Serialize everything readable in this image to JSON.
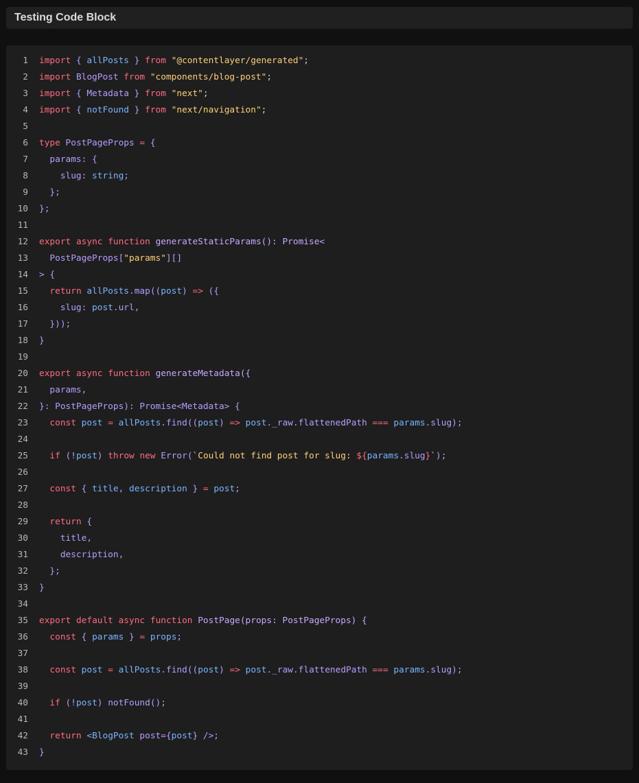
{
  "header": {
    "title": "Testing Code Block"
  },
  "colors": {
    "background": "#101010",
    "panel": "#1e1e1e",
    "keyword": "#ff6b81",
    "string": "#ffcf7a",
    "identifier": "#b79dff",
    "variable": "#7ab4ff",
    "line_number": "#b8b8b8"
  },
  "code": {
    "language": "tsx",
    "lines": [
      [
        [
          "kw",
          "import"
        ],
        [
          "id",
          " { "
        ],
        [
          "var",
          "allPosts"
        ],
        [
          "id",
          " } "
        ],
        [
          "kw",
          "from"
        ],
        [
          "pl",
          " "
        ],
        [
          "str",
          "\"@contentlayer/generated\""
        ],
        [
          "pl",
          ";"
        ]
      ],
      [
        [
          "kw",
          "import"
        ],
        [
          "id",
          " BlogPost "
        ],
        [
          "kw",
          "from"
        ],
        [
          "pl",
          " "
        ],
        [
          "str",
          "\"components/blog-post\""
        ],
        [
          "pl",
          ";"
        ]
      ],
      [
        [
          "kw",
          "import"
        ],
        [
          "id",
          " { Metadata } "
        ],
        [
          "kw",
          "from"
        ],
        [
          "pl",
          " "
        ],
        [
          "str",
          "\"next\""
        ],
        [
          "pl",
          ";"
        ]
      ],
      [
        [
          "kw",
          "import"
        ],
        [
          "id",
          " { "
        ],
        [
          "var",
          "notFound"
        ],
        [
          "id",
          " } "
        ],
        [
          "kw",
          "from"
        ],
        [
          "pl",
          " "
        ],
        [
          "str",
          "\"next/navigation\""
        ],
        [
          "pl",
          ";"
        ]
      ],
      [],
      [
        [
          "kw",
          "type"
        ],
        [
          "id",
          " PostPageProps "
        ],
        [
          "kw",
          "="
        ],
        [
          "id",
          " {"
        ]
      ],
      [
        [
          "id",
          "  params: {"
        ]
      ],
      [
        [
          "id",
          "    slug: "
        ],
        [
          "var",
          "string"
        ],
        [
          "id",
          ";"
        ]
      ],
      [
        [
          "id",
          "  };"
        ]
      ],
      [
        [
          "id",
          "};"
        ]
      ],
      [],
      [
        [
          "kw",
          "export"
        ],
        [
          "pl",
          " "
        ],
        [
          "kw",
          "async"
        ],
        [
          "pl",
          " "
        ],
        [
          "kw",
          "function"
        ],
        [
          "pl",
          " "
        ],
        [
          "fn",
          "generateStaticParams(): Promise<"
        ]
      ],
      [
        [
          "id",
          "  PostPageProps["
        ],
        [
          "str",
          "\"params\""
        ],
        [
          "id",
          "][]"
        ]
      ],
      [
        [
          "id",
          "> {"
        ]
      ],
      [
        [
          "id",
          "  "
        ],
        [
          "kw",
          "return"
        ],
        [
          "id",
          " "
        ],
        [
          "var",
          "allPosts"
        ],
        [
          "id",
          ".map(("
        ],
        [
          "var",
          "post"
        ],
        [
          "id",
          ") "
        ],
        [
          "kw",
          "=>"
        ],
        [
          "id",
          " ({"
        ]
      ],
      [
        [
          "id",
          "    slug: "
        ],
        [
          "var",
          "post"
        ],
        [
          "id",
          ".url,"
        ]
      ],
      [
        [
          "id",
          "  }));"
        ]
      ],
      [
        [
          "id",
          "}"
        ]
      ],
      [],
      [
        [
          "kw",
          "export"
        ],
        [
          "pl",
          " "
        ],
        [
          "kw",
          "async"
        ],
        [
          "pl",
          " "
        ],
        [
          "kw",
          "function"
        ],
        [
          "pl",
          " "
        ],
        [
          "fn",
          "generateMetadata({"
        ]
      ],
      [
        [
          "id",
          "  params,"
        ]
      ],
      [
        [
          "id",
          "}: PostPageProps): Promise<Metadata> {"
        ]
      ],
      [
        [
          "id",
          "  "
        ],
        [
          "kw",
          "const"
        ],
        [
          "id",
          " "
        ],
        [
          "var",
          "post"
        ],
        [
          "id",
          " "
        ],
        [
          "kw",
          "="
        ],
        [
          "id",
          " "
        ],
        [
          "var",
          "allPosts"
        ],
        [
          "id",
          ".find(("
        ],
        [
          "var",
          "post"
        ],
        [
          "id",
          ") "
        ],
        [
          "kw",
          "=>"
        ],
        [
          "id",
          " "
        ],
        [
          "var",
          "post"
        ],
        [
          "id",
          "._raw.flattenedPath "
        ],
        [
          "kw",
          "==="
        ],
        [
          "id",
          " "
        ],
        [
          "var",
          "params"
        ],
        [
          "id",
          ".slug);"
        ]
      ],
      [],
      [
        [
          "id",
          "  "
        ],
        [
          "kw",
          "if"
        ],
        [
          "id",
          " (!"
        ],
        [
          "var",
          "post"
        ],
        [
          "id",
          ") "
        ],
        [
          "kw",
          "throw"
        ],
        [
          "id",
          " "
        ],
        [
          "kw",
          "new"
        ],
        [
          "id",
          " Error("
        ],
        [
          "str",
          "`Could not find post for slug: "
        ],
        [
          "kw",
          "${"
        ],
        [
          "var",
          "params"
        ],
        [
          "id",
          ".slug"
        ],
        [
          "kw",
          "}"
        ],
        [
          "str",
          "`"
        ],
        [
          "id",
          ");"
        ]
      ],
      [],
      [
        [
          "id",
          "  "
        ],
        [
          "kw",
          "const"
        ],
        [
          "id",
          " { "
        ],
        [
          "var",
          "title"
        ],
        [
          "id",
          ", "
        ],
        [
          "var",
          "description"
        ],
        [
          "id",
          " } "
        ],
        [
          "kw",
          "="
        ],
        [
          "id",
          " "
        ],
        [
          "var",
          "post"
        ],
        [
          "id",
          ";"
        ]
      ],
      [],
      [
        [
          "id",
          "  "
        ],
        [
          "kw",
          "return"
        ],
        [
          "id",
          " {"
        ]
      ],
      [
        [
          "id",
          "    title,"
        ]
      ],
      [
        [
          "id",
          "    description,"
        ]
      ],
      [
        [
          "id",
          "  };"
        ]
      ],
      [
        [
          "id",
          "}"
        ]
      ],
      [],
      [
        [
          "kw",
          "export"
        ],
        [
          "pl",
          " "
        ],
        [
          "kw",
          "default"
        ],
        [
          "pl",
          " "
        ],
        [
          "kw",
          "async"
        ],
        [
          "pl",
          " "
        ],
        [
          "kw",
          "function"
        ],
        [
          "pl",
          " "
        ],
        [
          "fn",
          "PostPage(props: PostPageProps) {"
        ]
      ],
      [
        [
          "id",
          "  "
        ],
        [
          "kw",
          "const"
        ],
        [
          "id",
          " { "
        ],
        [
          "var",
          "params"
        ],
        [
          "id",
          " } "
        ],
        [
          "kw",
          "="
        ],
        [
          "id",
          " "
        ],
        [
          "var",
          "props"
        ],
        [
          "id",
          ";"
        ]
      ],
      [],
      [
        [
          "id",
          "  "
        ],
        [
          "kw",
          "const"
        ],
        [
          "id",
          " "
        ],
        [
          "var",
          "post"
        ],
        [
          "id",
          " "
        ],
        [
          "kw",
          "="
        ],
        [
          "id",
          " "
        ],
        [
          "var",
          "allPosts"
        ],
        [
          "id",
          ".find(("
        ],
        [
          "var",
          "post"
        ],
        [
          "id",
          ") "
        ],
        [
          "kw",
          "=>"
        ],
        [
          "id",
          " "
        ],
        [
          "var",
          "post"
        ],
        [
          "id",
          "._raw.flattenedPath "
        ],
        [
          "kw",
          "==="
        ],
        [
          "id",
          " "
        ],
        [
          "var",
          "params"
        ],
        [
          "id",
          ".slug);"
        ]
      ],
      [],
      [
        [
          "id",
          "  "
        ],
        [
          "kw",
          "if"
        ],
        [
          "id",
          " (!"
        ],
        [
          "var",
          "post"
        ],
        [
          "id",
          ") notFound();"
        ]
      ],
      [],
      [
        [
          "id",
          "  "
        ],
        [
          "kw",
          "return"
        ],
        [
          "id",
          " "
        ],
        [
          "var",
          "<BlogPost"
        ],
        [
          "id",
          " post={"
        ],
        [
          "var",
          "post"
        ],
        [
          "id",
          "} />;"
        ]
      ],
      [
        [
          "id",
          "}"
        ]
      ]
    ]
  }
}
